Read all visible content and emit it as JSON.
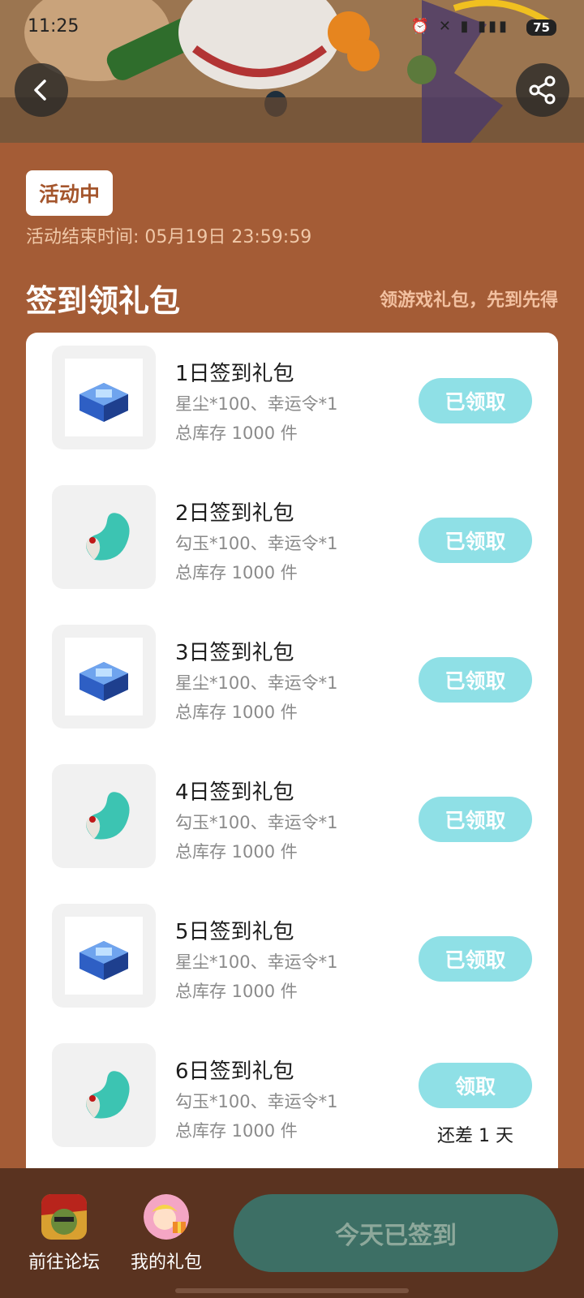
{
  "status_bar": {
    "time": "11:25",
    "battery": "75"
  },
  "header": {
    "back_icon": "chevron-left-icon",
    "share_icon": "share-icon"
  },
  "activity": {
    "status": "活动中",
    "end_time": "活动结束时间: 05月19日 23:59:59"
  },
  "section": {
    "title": "签到领礼包",
    "subtitle": "领游戏礼包，先到先得"
  },
  "gifts": [
    {
      "title": "1日签到礼包",
      "desc": "星尘*100、幸运令*1",
      "stock": "总库存 1000 件",
      "button": "已领取",
      "icon": "chest-icon"
    },
    {
      "title": "2日签到礼包",
      "desc": "勾玉*100、幸运令*1",
      "stock": "总库存 1000 件",
      "button": "已领取",
      "icon": "magatama-icon"
    },
    {
      "title": "3日签到礼包",
      "desc": "星尘*100、幸运令*1",
      "stock": "总库存 1000 件",
      "button": "已领取",
      "icon": "chest-icon"
    },
    {
      "title": "4日签到礼包",
      "desc": "勾玉*100、幸运令*1",
      "stock": "总库存 1000 件",
      "button": "已领取",
      "icon": "magatama-icon"
    },
    {
      "title": "5日签到礼包",
      "desc": "星尘*100、幸运令*1",
      "stock": "总库存 1000 件",
      "button": "已领取",
      "icon": "chest-icon"
    },
    {
      "title": "6日签到礼包",
      "desc": "勾玉*100、幸运令*1",
      "stock": "总库存 1000 件",
      "button": "领取",
      "remaining": "还差 1 天",
      "icon": "magatama-icon"
    }
  ],
  "bottom_nav": {
    "forum": "前往论坛",
    "my_gifts": "我的礼包",
    "signin": "今天已签到"
  },
  "colors": {
    "background": "#a45c36",
    "button_claim": "#8fe0e6",
    "signin_button": "#3d6f65",
    "bottom_bar": "#5a3320"
  }
}
